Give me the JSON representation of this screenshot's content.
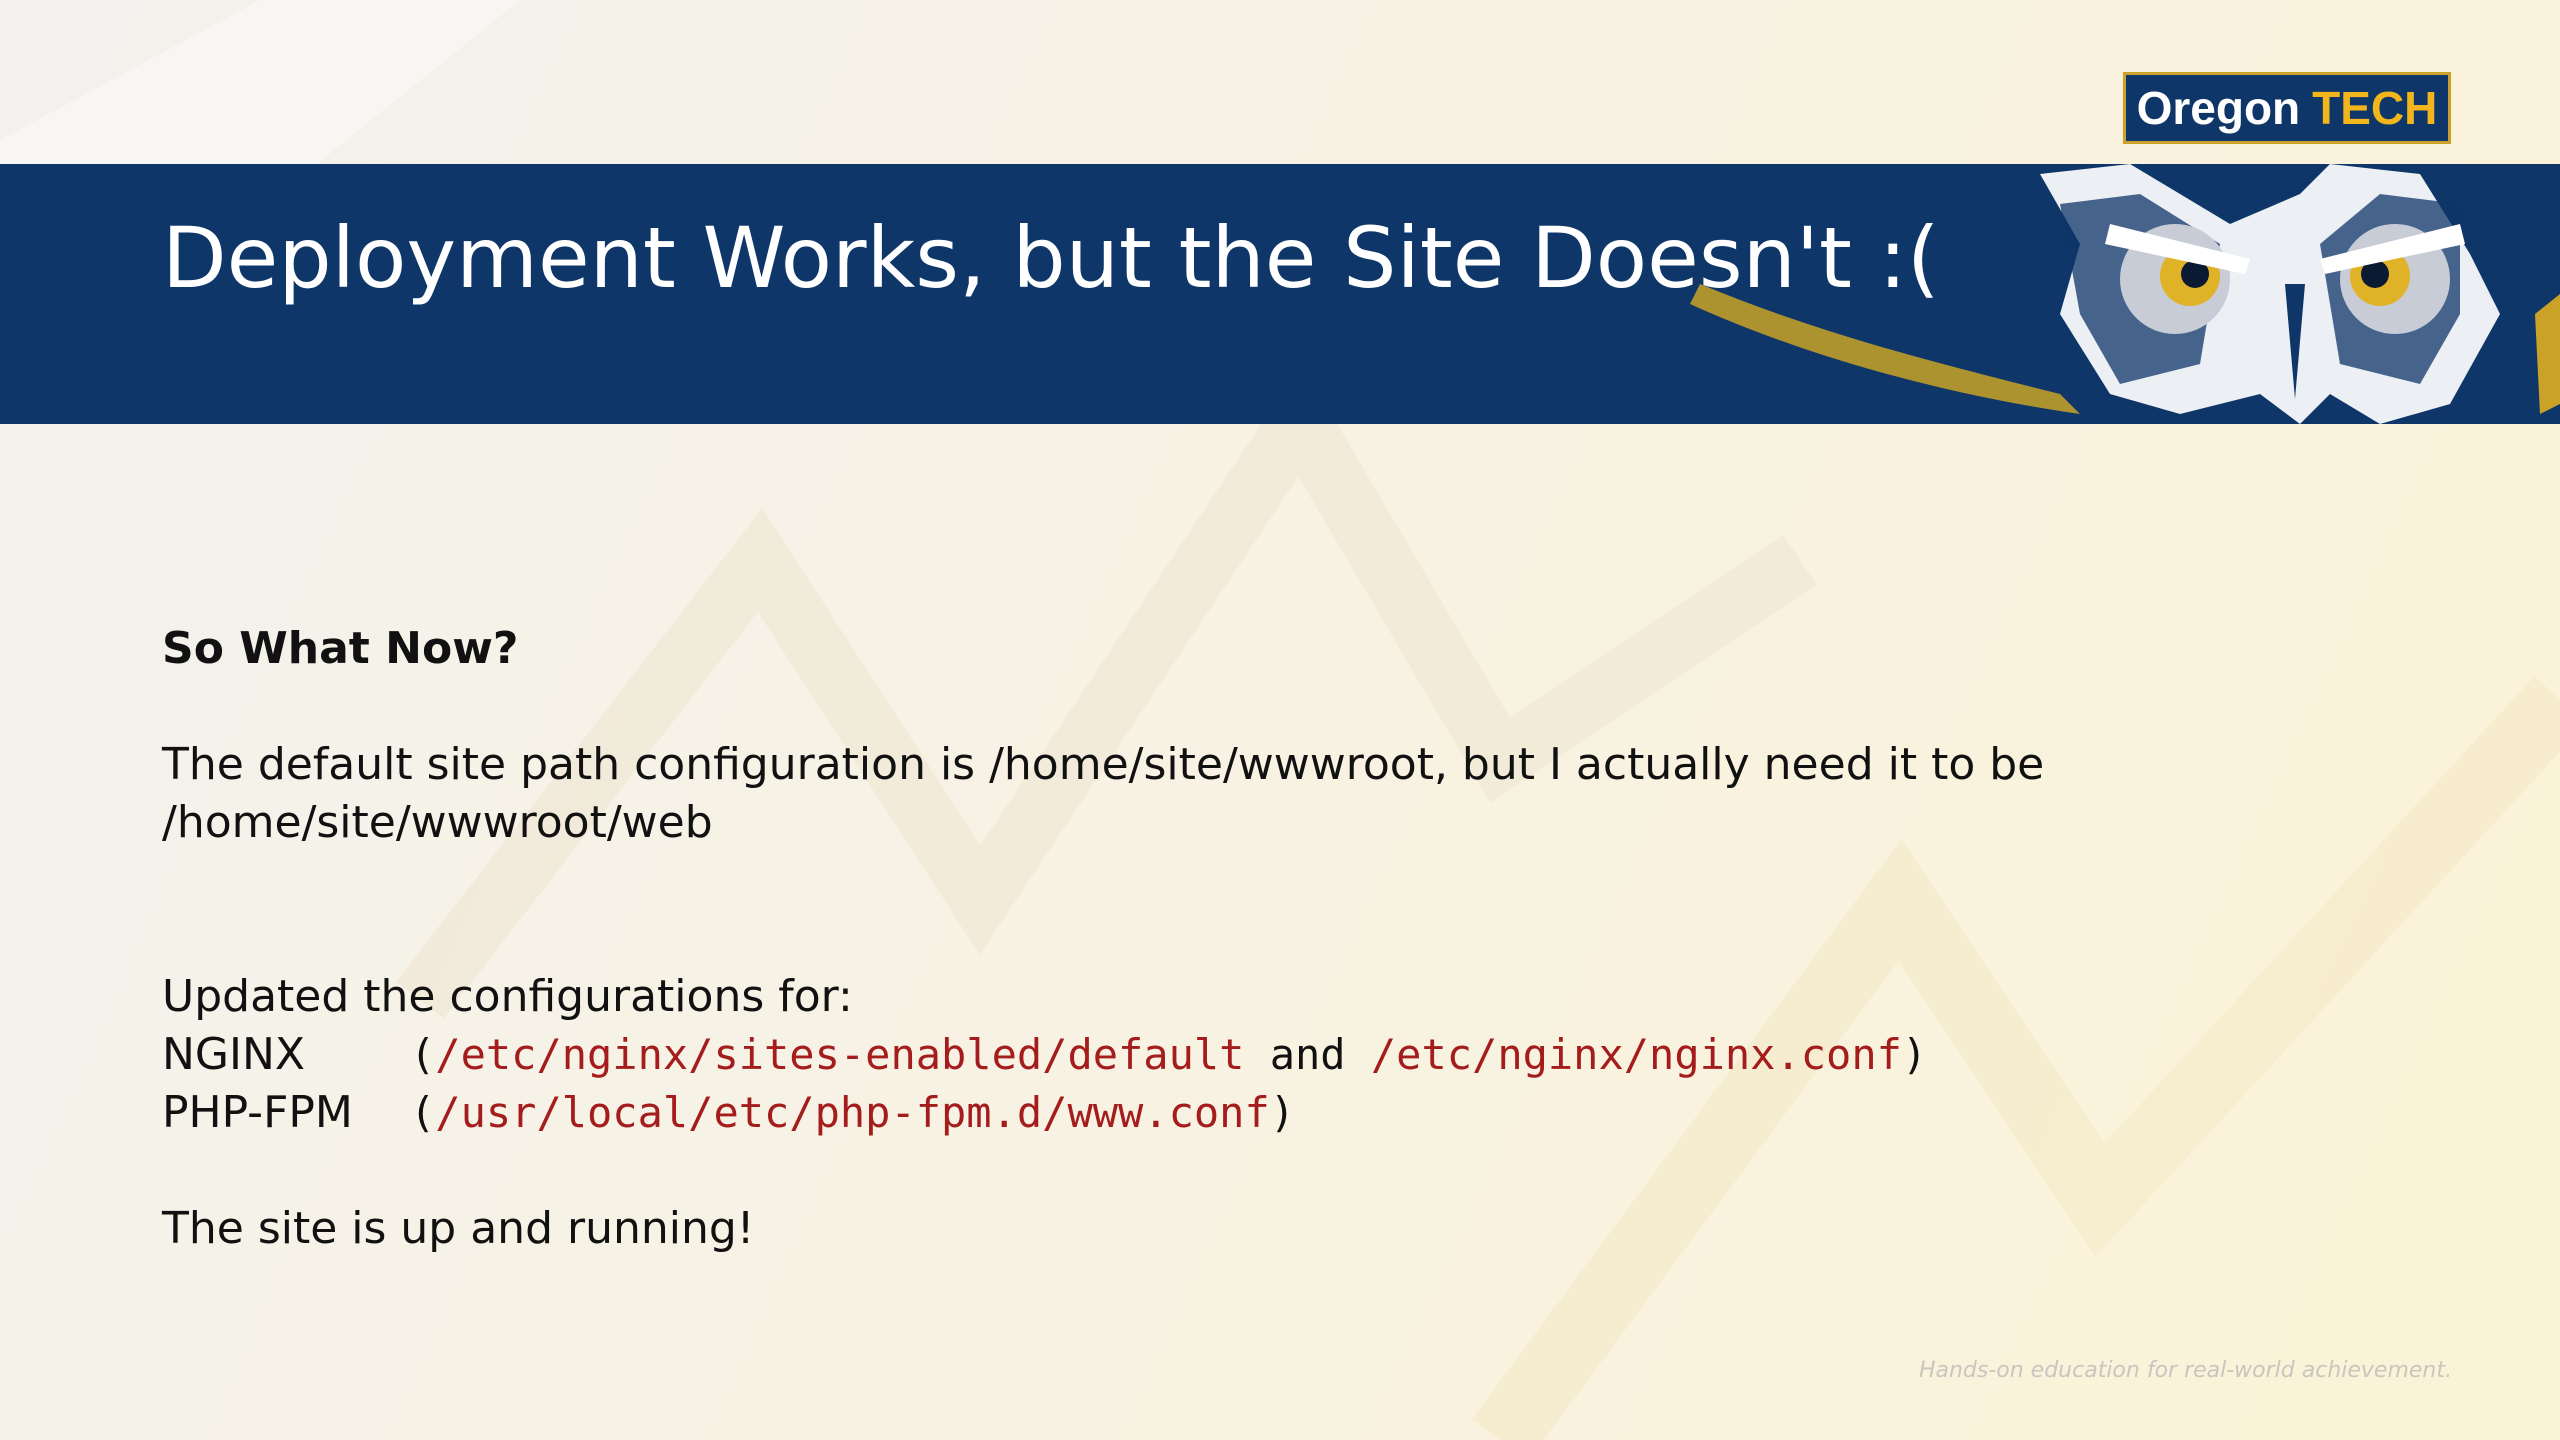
{
  "logo": {
    "word1": "Oregon",
    "word2": "TECH"
  },
  "slide": {
    "title": "Deployment Works, but the Site Doesn't :("
  },
  "content": {
    "heading": "So What Now?",
    "para_line1": "The default site path configuration is /home/site/wwwroot, but I actually need it to be",
    "para_line2": "/home/site/wwwroot/web",
    "updated_intro": "Updated the configurations for:",
    "nginx": {
      "label": "NGINX",
      "open": "(",
      "path1": "/etc/nginx/sites-enabled/default",
      "joiner": " and ",
      "path2": "/etc/nginx/nginx.conf",
      "close": ")"
    },
    "phpfpm": {
      "label": "PHP-FPM",
      "open": "(",
      "path": "/usr/local/etc/php-fpm.d/www.conf",
      "close": ")"
    },
    "conclusion": "The site is up and running!"
  },
  "footer": {
    "tagline": "Hands-on education for real-world achievement."
  },
  "colors": {
    "banner": "#0f3668",
    "accent_gold": "#c9a227",
    "code_red": "#a51c1c"
  },
  "icons": {
    "mascot": "owl-mascot-icon"
  }
}
